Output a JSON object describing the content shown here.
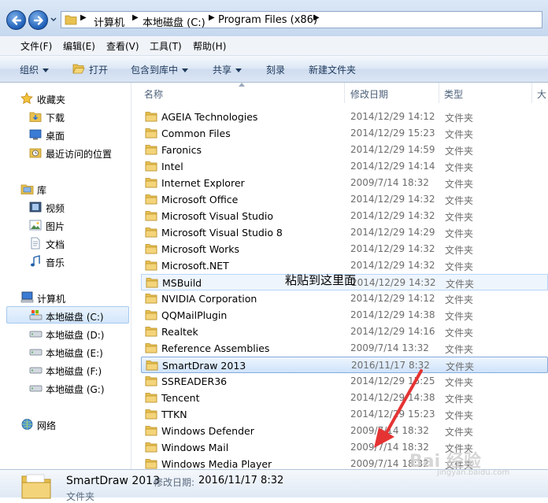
{
  "address": {
    "crumbs": [
      "计算机",
      "本地磁盘 (C:)",
      "Program Files (x86)"
    ]
  },
  "menu": [
    "文件(F)",
    "编辑(E)",
    "查看(V)",
    "工具(T)",
    "帮助(H)"
  ],
  "commands": {
    "organize": "组织",
    "open": "打开",
    "include": "包含到库中",
    "share": "共享",
    "burn": "刻录",
    "new_folder": "新建文件夹"
  },
  "nav": {
    "favorites": "收藏夹",
    "downloads": "下载",
    "desktop": "桌面",
    "recent": "最近访问的位置",
    "libraries": "库",
    "videos": "视频",
    "pictures": "图片",
    "documents": "文档",
    "music": "音乐",
    "computer": "计算机",
    "drive_c": "本地磁盘 (C:)",
    "drive_d": "本地磁盘 (D:)",
    "drive_e": "本地磁盘 (E:)",
    "drive_f": "本地磁盘 (F:)",
    "drive_g": "本地磁盘 (G:)",
    "network": "网络"
  },
  "columns": {
    "name": "名称",
    "date": "修改日期",
    "type": "类型",
    "size": "大"
  },
  "files": [
    {
      "name": "AGEIA Technologies",
      "date": "2014/12/29 14:12",
      "type": "文件夹"
    },
    {
      "name": "Common Files",
      "date": "2014/12/29 15:23",
      "type": "文件夹"
    },
    {
      "name": "Faronics",
      "date": "2014/12/29 14:59",
      "type": "文件夹"
    },
    {
      "name": "Intel",
      "date": "2014/12/29 14:14",
      "type": "文件夹"
    },
    {
      "name": "Internet Explorer",
      "date": "2009/7/14 18:32",
      "type": "文件夹"
    },
    {
      "name": "Microsoft Office",
      "date": "2014/12/29 14:32",
      "type": "文件夹"
    },
    {
      "name": "Microsoft Visual Studio",
      "date": "2014/12/29 14:32",
      "type": "文件夹"
    },
    {
      "name": "Microsoft Visual Studio 8",
      "date": "2014/12/29 14:29",
      "type": "文件夹"
    },
    {
      "name": "Microsoft Works",
      "date": "2014/12/29 14:32",
      "type": "文件夹"
    },
    {
      "name": "Microsoft.NET",
      "date": "2014/12/29 14:32",
      "type": "文件夹"
    },
    {
      "name": "MSBuild",
      "date": "2014/12/29 14:32",
      "type": "文件夹"
    },
    {
      "name": "NVIDIA Corporation",
      "date": "2014/12/29 14:12",
      "type": "文件夹"
    },
    {
      "name": "QQMailPlugin",
      "date": "2014/12/29 14:38",
      "type": "文件夹"
    },
    {
      "name": "Realtek",
      "date": "2014/12/29 14:16",
      "type": "文件夹"
    },
    {
      "name": "Reference Assemblies",
      "date": "2009/7/14 13:32",
      "type": "文件夹"
    },
    {
      "name": "SmartDraw 2013",
      "date": "2016/11/17 8:32",
      "type": "文件夹"
    },
    {
      "name": "SSREADER36",
      "date": "2014/12/29 15:25",
      "type": "文件夹"
    },
    {
      "name": "Tencent",
      "date": "2014/12/29 14:38",
      "type": "文件夹"
    },
    {
      "name": "TTKN",
      "date": "2014/12/29 15:23",
      "type": "文件夹"
    },
    {
      "name": "Windows Defender",
      "date": "2009/7/14 18:32",
      "type": "文件夹"
    },
    {
      "name": "Windows Mail",
      "date": "2009/7/14 18:32",
      "type": "文件夹"
    },
    {
      "name": "Windows Media Player",
      "date": "2009/7/14 18:32",
      "type": "文件夹"
    }
  ],
  "annotation": "粘贴到这里面",
  "details": {
    "name": "SmartDraw 2013",
    "date_label": "修改日期:",
    "date": "2016/11/17 8:32",
    "type": "文件夹"
  },
  "watermark": {
    "main": "Bai 经验",
    "sub": "jingyan.baidu.com"
  },
  "colors": {
    "selection": "#cfe3fb",
    "folder": "#e8c150",
    "arrow": "#e53333"
  }
}
